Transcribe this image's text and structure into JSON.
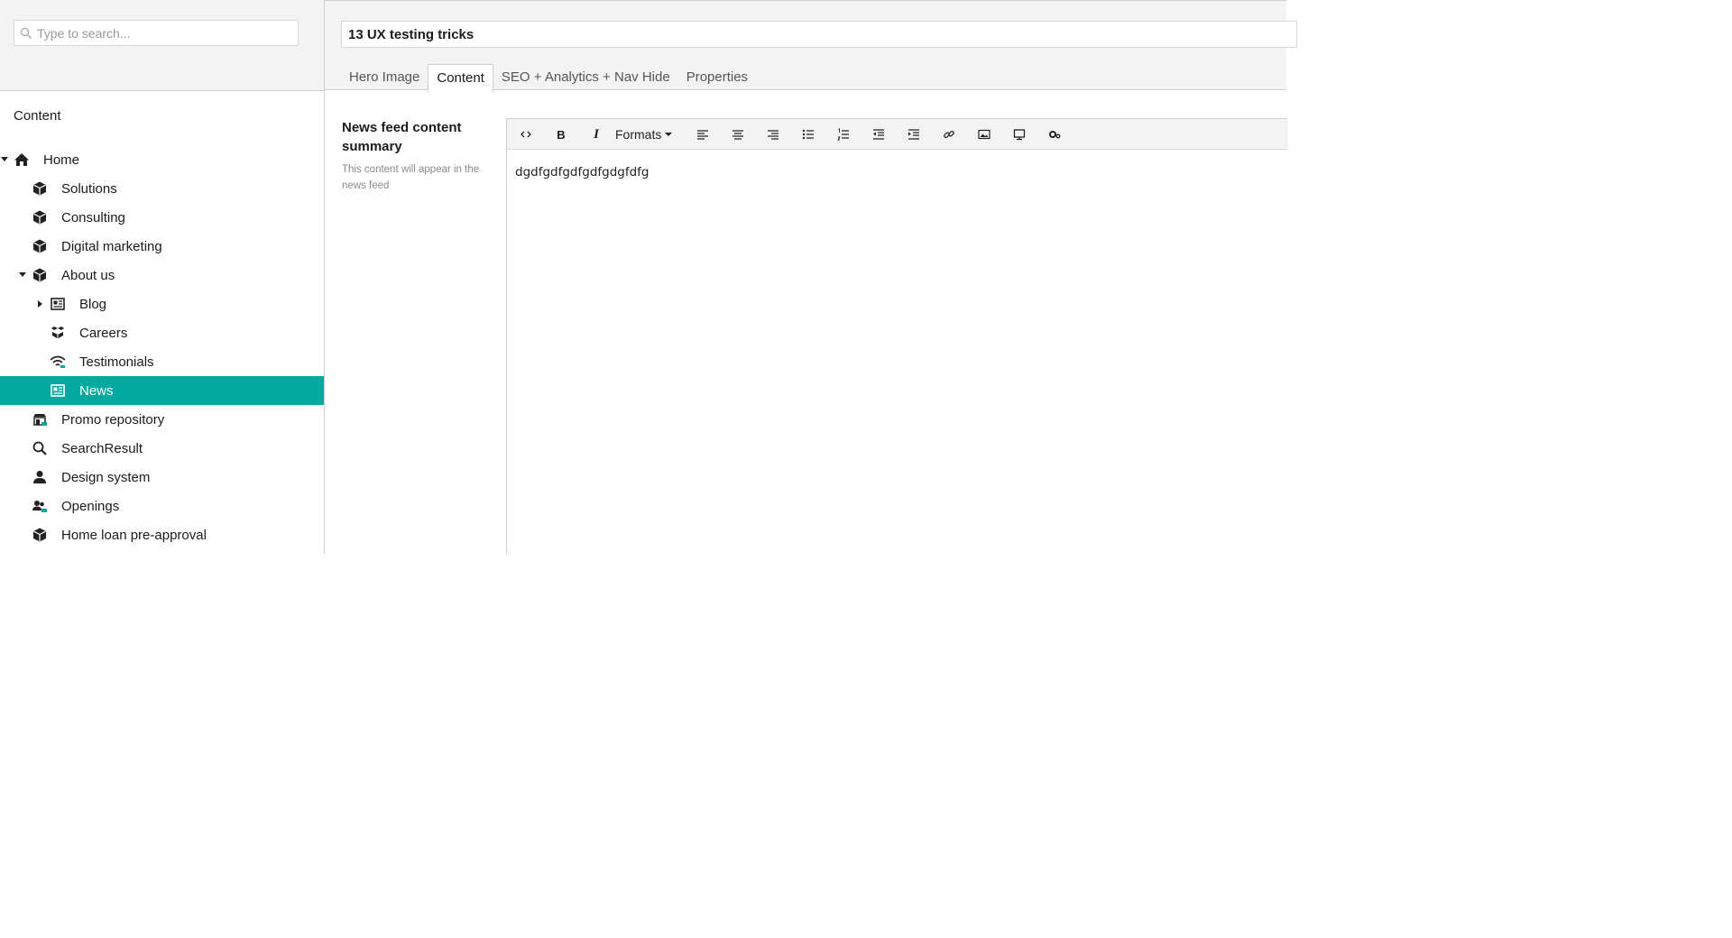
{
  "search": {
    "placeholder": "Type to search..."
  },
  "sidebar": {
    "section_title": "Content",
    "tree": [
      {
        "label": "Home",
        "icon": "home-icon",
        "expanded": true
      },
      {
        "label": "Solutions",
        "icon": "cube-icon"
      },
      {
        "label": "Consulting",
        "icon": "cube-icon"
      },
      {
        "label": "Digital marketing",
        "icon": "cube-icon"
      },
      {
        "label": "About us",
        "icon": "cube-icon",
        "expanded": true
      },
      {
        "label": "Blog",
        "icon": "newspaper-icon",
        "collapsed": true
      },
      {
        "label": "Careers",
        "icon": "boxes-icon"
      },
      {
        "label": "Testimonials",
        "icon": "wifi-icon"
      },
      {
        "label": "News",
        "icon": "newspaper-icon",
        "selected": true
      },
      {
        "label": "Promo repository",
        "icon": "store-icon"
      },
      {
        "label": "SearchResult",
        "icon": "search-icon"
      },
      {
        "label": "Design system",
        "icon": "user-icon"
      },
      {
        "label": "Openings",
        "icon": "users-icon"
      },
      {
        "label": "Home loan pre-approval",
        "icon": "cube-icon"
      }
    ]
  },
  "document": {
    "title": "13 UX testing tricks"
  },
  "tabs": [
    {
      "label": "Hero Image"
    },
    {
      "label": "Content",
      "active": true
    },
    {
      "label": "SEO + Analytics + Nav Hide"
    },
    {
      "label": "Properties"
    }
  ],
  "field": {
    "label": "News feed content summary",
    "description": "This content will appear in the news feed"
  },
  "editor": {
    "toolbar": {
      "code": "code-icon",
      "bold": "B",
      "italic": "I",
      "formats": "Formats",
      "buttons": [
        "align-left-icon",
        "align-center-icon",
        "align-right-icon",
        "bullet-list-icon",
        "numbered-list-icon",
        "outdent-icon",
        "indent-icon",
        "link-icon",
        "image-icon",
        "embed-icon",
        "macro-icon"
      ]
    },
    "body": "dgdfgdfgdfgdfgdgfdfg"
  },
  "colors": {
    "accent": "#03a89e",
    "panel_bg": "#f3f3f3",
    "border": "#cfcfcf"
  }
}
